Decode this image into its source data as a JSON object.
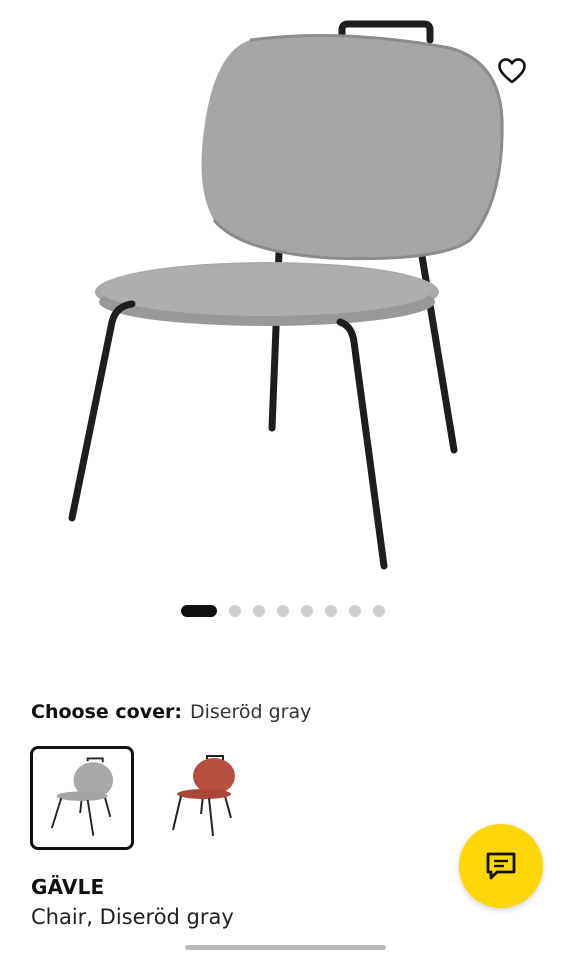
{
  "carousel": {
    "slide_count": 8,
    "active_index": 0
  },
  "cover": {
    "label": "Choose cover:",
    "value": "Diseröd gray",
    "options": [
      {
        "name": "Diseröd gray",
        "color": "#a9a9a9",
        "selected": true
      },
      {
        "name": "red cover",
        "color": "#b5503f",
        "selected": false
      }
    ]
  },
  "product": {
    "name": "GÄVLE",
    "description": "Chair, Diseröd gray"
  },
  "icons": {
    "favorite": "heart-icon",
    "chat": "chat-bubble-icon"
  },
  "colors": {
    "accent": "#ffd60a",
    "text": "#111111",
    "dot_inactive": "#cfcfcf"
  }
}
